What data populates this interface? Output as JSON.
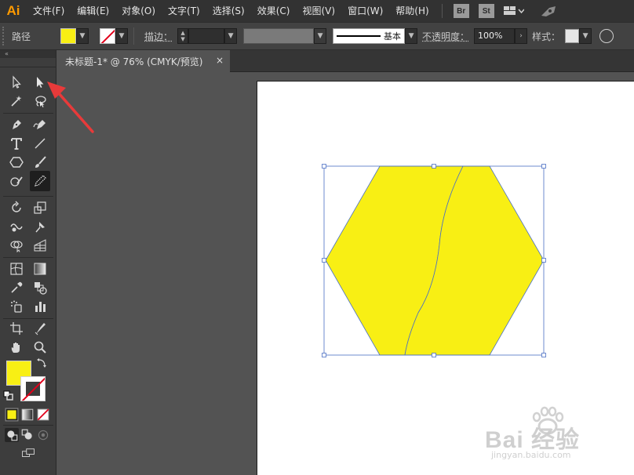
{
  "app": {
    "logo_text": "Ai"
  },
  "menu": [
    {
      "label": "文件(F)"
    },
    {
      "label": "编辑(E)"
    },
    {
      "label": "对象(O)"
    },
    {
      "label": "文字(T)"
    },
    {
      "label": "选择(S)"
    },
    {
      "label": "效果(C)"
    },
    {
      "label": "视图(V)"
    },
    {
      "label": "窗口(W)"
    },
    {
      "label": "帮助(H)"
    }
  ],
  "menu_badges": {
    "bridge": "Br",
    "stock": "St"
  },
  "controlbar": {
    "selection_type": "路径",
    "fill_color": "#f8ef14",
    "stroke_label": "描边：",
    "stroke_weight": "",
    "stroke_style": "基本",
    "opacity_label": "不透明度：",
    "opacity_value": "100%",
    "style_label": "样式："
  },
  "document_tab": {
    "title": "未标题-1* @ 76% (CMYK/预览)",
    "close_symbol": "×"
  },
  "tools": {
    "fill_color": "#f8ef14",
    "stroke_color": "#e2001a",
    "active_tool": "eyedropper-tool"
  },
  "artwork": {
    "shape": "hexagon",
    "fill": "#f8ef14",
    "stroke": "#4a6fc4"
  },
  "annotation": {
    "arrow_color": "#e83a3a",
    "points_to": "direct-selection-tool"
  },
  "watermark": {
    "brand": "Bai 经验",
    "url": "jingyan.baidu.com"
  }
}
